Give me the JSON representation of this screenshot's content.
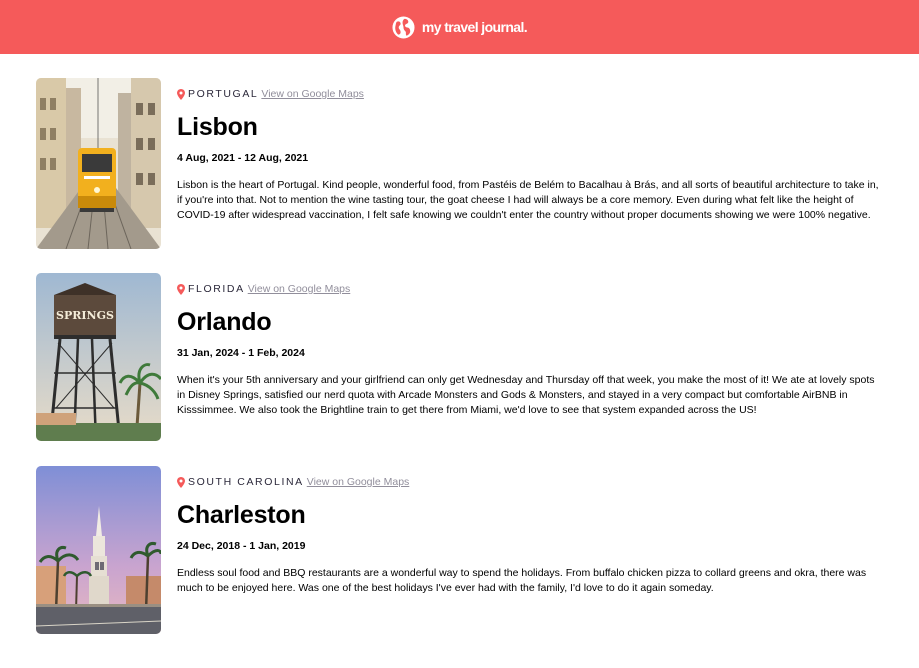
{
  "header": {
    "brand": "my travel journal.",
    "icon": "globe-icon",
    "bg_color": "#f55a5a"
  },
  "entries": [
    {
      "country": "PORTUGAL",
      "maps_link": "View on Google Maps",
      "place": "Lisbon",
      "dates": "4 Aug, 2021 - 12 Aug, 2021",
      "description": "Lisbon is the heart of Portugal. Kind people, wonderful food, from Pastéis de Belém to Bacalhau à Brás, and all sorts of beautiful architecture to take in, if you're into that. Not to mention the wine tasting tour, the goat cheese I had will always be a core memory. Even during what felt like the height of COVID-19 after widespread vaccination, I felt safe knowing we couldn't enter the country without proper documents showing we were 100% negative."
    },
    {
      "country": "FLORIDA",
      "maps_link": "View on Google Maps",
      "place": "Orlando",
      "dates": "31 Jan, 2024 - 1 Feb, 2024",
      "description": "When it's your 5th anniversary and your girlfriend can only get Wednesday and Thursday off that week, you make the most of it! We ate at lovely spots in Disney Springs, satisfied our nerd quota with Arcade Monsters and Gods & Monsters, and stayed in a very compact but comfortable AirBNB in Kisssimmee. We also took the Brightline train to get there from Miami, we'd love to see that system expanded across the US!",
      "photo_sign": "SPRINGS"
    },
    {
      "country": "SOUTH CAROLINA",
      "maps_link": "View on Google Maps",
      "place": "Charleston",
      "dates": "24 Dec, 2018 - 1 Jan, 2019",
      "description": "Endless soul food and BBQ restaurants are a wonderful way to spend the holidays. From buffalo chicken pizza to collard greens and okra, there was much to be enjoyed here. Was one of the best holidays I've ever had with the family, I'd love to do it again someday."
    }
  ],
  "pin_icon": "location-pin-icon",
  "pin_color": "#f55a5a"
}
